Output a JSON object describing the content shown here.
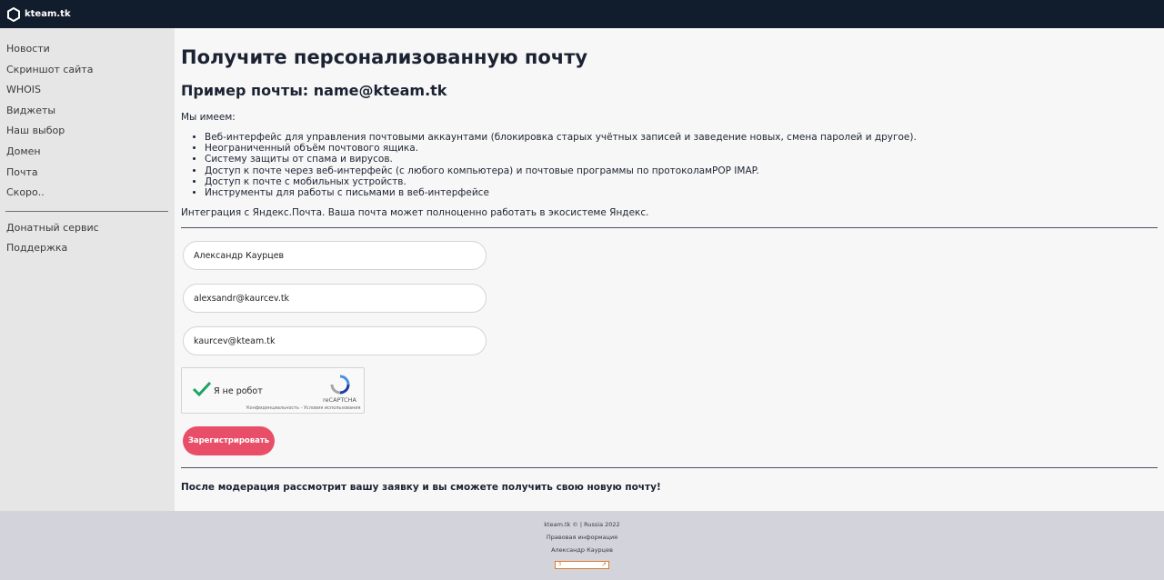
{
  "header": {
    "brand": "kteam.tk",
    "logo_icon": "hexagon-logo-icon"
  },
  "sidebar": {
    "items": [
      {
        "label": "Новости"
      },
      {
        "label": "Скриншот сайта"
      },
      {
        "label": "WHOIS"
      },
      {
        "label": "Виджеты"
      },
      {
        "label": "Наш выбор"
      },
      {
        "label": "Домен"
      },
      {
        "label": "Почта"
      },
      {
        "label": "Скоро.."
      }
    ],
    "secondary": [
      {
        "label": "Донатный сервис"
      },
      {
        "label": "Поддержка"
      }
    ]
  },
  "main": {
    "title": "Получите персонализованную почту",
    "subtitle": "Пример почты: name@kteam.tk",
    "intro": "Мы имеем:",
    "features": [
      "Веб-интерфейс для управления почтовыми аккаунтами (блокировка старых учётных записей и заведение новых, смена паролей и другое).",
      "Неограниченный объём почтового ящика.",
      "Систему защиты от спама и вирусов.",
      "Доступ к почте через веб-интерфейс (с любого компьютера) и почтовые программы по протоколамPOP IMAP.",
      "Доступ к почте с мобильных устройств.",
      "Инструменты для работы с письмами в веб-интерфейсе"
    ],
    "integration": "Интеграция с Яндекс.Почта. Ваша почта может полноценно работать в экосистеме Яндекс."
  },
  "form": {
    "name_value": "Александр Каурцев",
    "email_value": "alexsandr@kaurcev.tk",
    "desired_value": "kaurcev@kteam.tk",
    "captcha": {
      "label": "Я не робот",
      "brand": "reCAPTCHA",
      "terms": "Конфиденциальность - Условия использования"
    },
    "submit_label": "Зарегистрировать"
  },
  "notice": "После модерация рассмотрит вашу заявку и вы сможете получить свою новую почту!",
  "footer": {
    "copyright": "kteam.tk © | Russia 2022",
    "legal": "Правовая информация",
    "author": "Александр Каурцев",
    "counter_text": "3"
  },
  "colors": {
    "topbar": "#111c2c",
    "sidebar": "#e6e6e6",
    "accent": "#e94e68",
    "footer": "#d3d4db",
    "captcha_check": "#1ea362"
  }
}
